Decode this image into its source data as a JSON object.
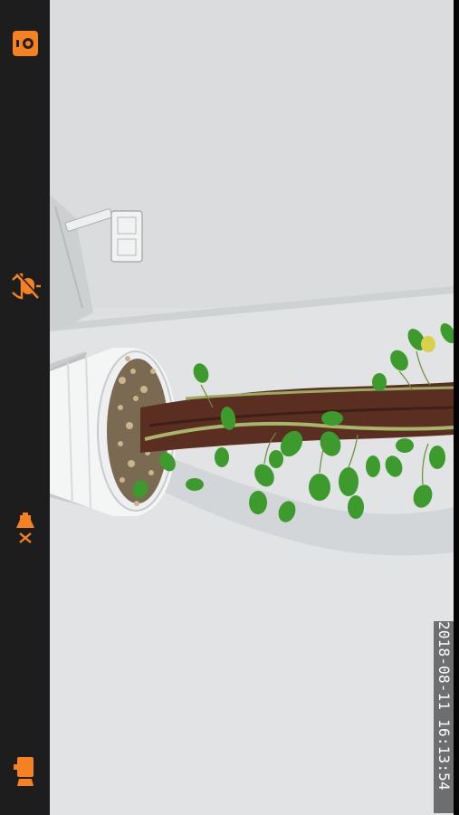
{
  "feed": {
    "timestamp": "2018-08-11 16:13:54"
  },
  "controls": {
    "items": [
      {
        "icon": "snapshot-icon"
      },
      {
        "icon": "mute-microphone-icon"
      },
      {
        "icon": "alarm-off-icon"
      },
      {
        "icon": "intercom-icon"
      }
    ]
  },
  "colors": {
    "accent": "#f58220",
    "sidebar": "#202020",
    "timestamp_text": "#ffffff"
  }
}
